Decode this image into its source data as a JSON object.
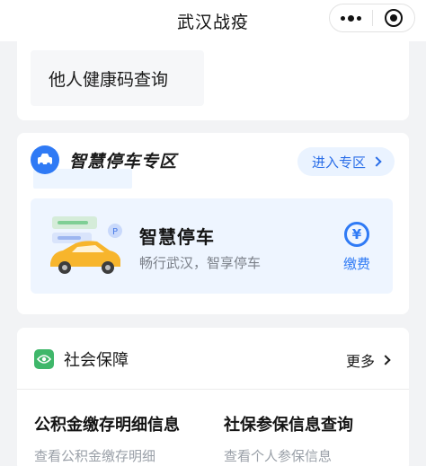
{
  "navbar": {
    "title": "武汉战疫"
  },
  "health": {
    "other_query_label": "他人健康码查询"
  },
  "parking": {
    "section_title": "智慧停车专区",
    "enter_label": "进入专区",
    "card_title": "智慧停车",
    "card_subtitle": "畅行武汉，智享停车",
    "pay_symbol": "¥",
    "pay_label": "缴费",
    "accent_color": "#2f7af5"
  },
  "social": {
    "title": "社会保障",
    "more_label": "更多",
    "items": [
      {
        "title": "公积金缴存明细信息",
        "subtitle": "查看公积金缴存明细"
      },
      {
        "title": "社保参保信息查询",
        "subtitle": "查看个人参保信息"
      }
    ],
    "accent_color": "#3fb76a"
  }
}
